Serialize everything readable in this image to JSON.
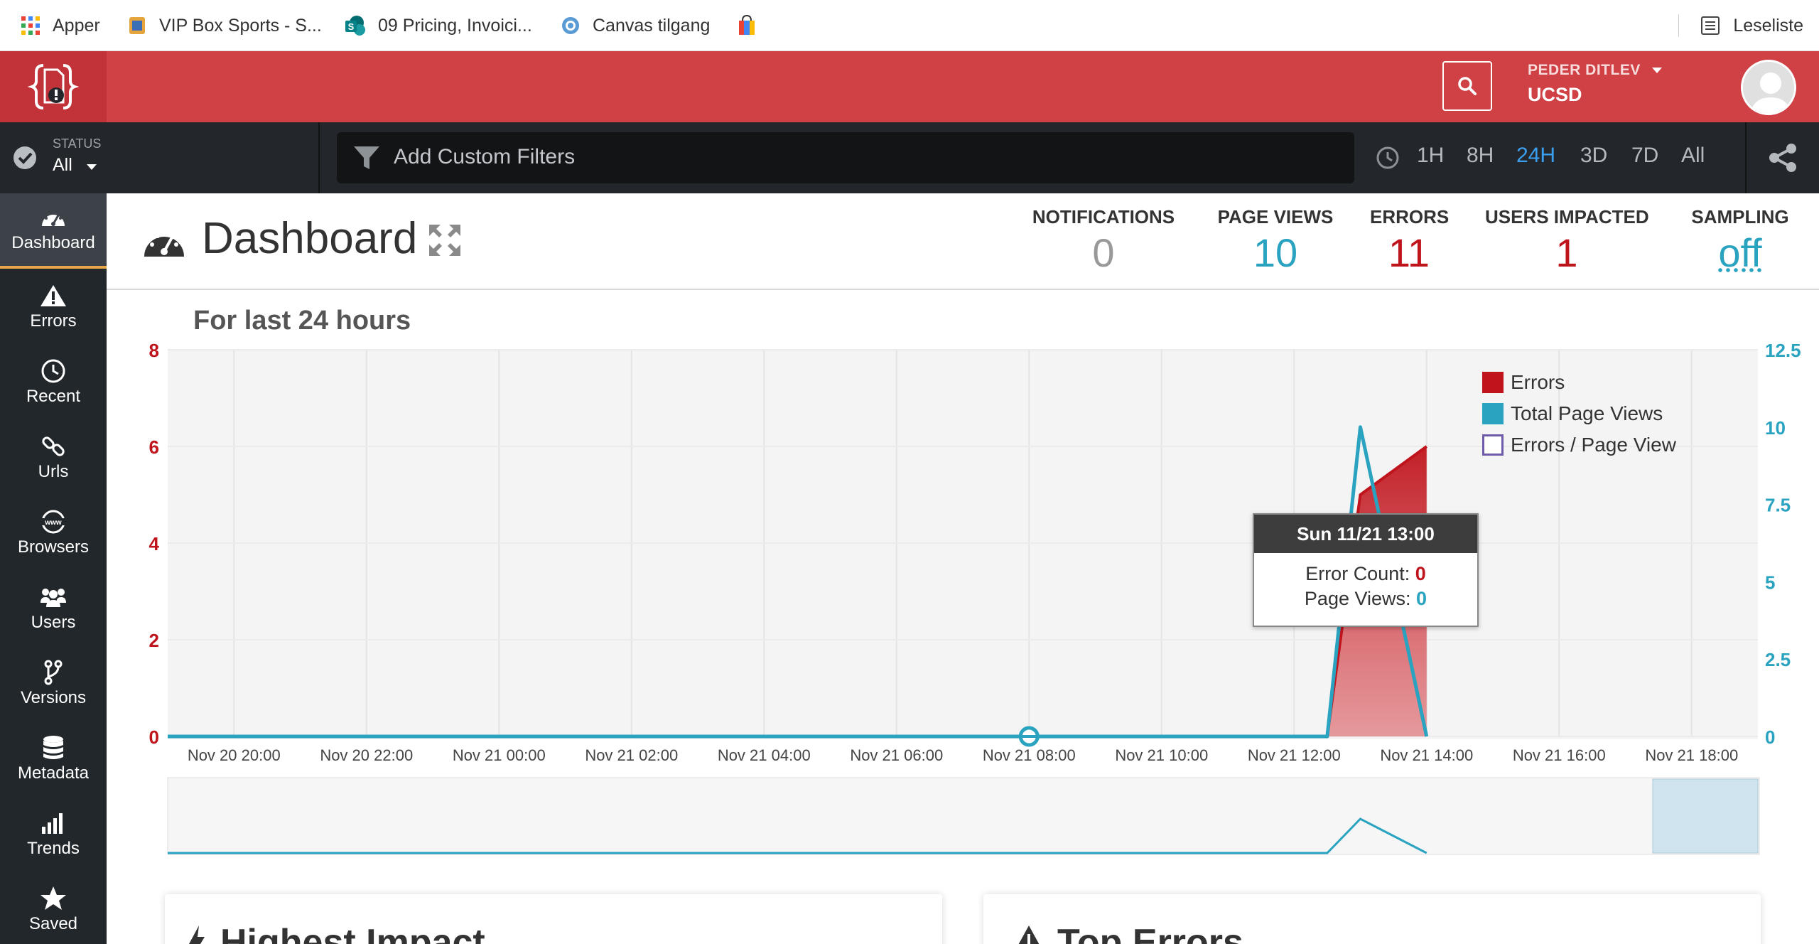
{
  "bookmarks": [
    {
      "label": "Apper",
      "icon": "apps-grid-icon"
    },
    {
      "label": "VIP Box Sports - S...",
      "icon": "vipbox-icon"
    },
    {
      "label": "09 Pricing, Invoici...",
      "icon": "sharepoint-icon"
    },
    {
      "label": "Canvas tilgang",
      "icon": "canvas-icon"
    },
    {
      "label": "",
      "icon": "shopping-bag-icon"
    }
  ],
  "reading_list": "Leseliste",
  "header": {
    "user_name": "PEDER DITLEV",
    "org": "UCSD"
  },
  "filterbar": {
    "status_label": "STATUS",
    "status_value": "All",
    "filter_placeholder": "Add Custom Filters",
    "ranges": [
      "1H",
      "8H",
      "24H",
      "3D",
      "7D",
      "All"
    ],
    "active_range": "24H"
  },
  "sidebar": [
    {
      "label": "Dashboard",
      "icon": "dashboard-gauge-icon",
      "active": true
    },
    {
      "label": "Errors",
      "icon": "warning-icon"
    },
    {
      "label": "Recent",
      "icon": "clock-icon"
    },
    {
      "label": "Urls",
      "icon": "link-icon"
    },
    {
      "label": "Browsers",
      "icon": "www-globe-icon"
    },
    {
      "label": "Users",
      "icon": "users-icon"
    },
    {
      "label": "Versions",
      "icon": "branch-icon"
    },
    {
      "label": "Metadata",
      "icon": "database-icon"
    },
    {
      "label": "Trends",
      "icon": "bar-chart-icon"
    },
    {
      "label": "Saved",
      "icon": "star-icon"
    }
  ],
  "dashboard": {
    "title": "Dashboard",
    "stats": [
      {
        "label": "NOTIFICATIONS",
        "value": "0",
        "color": "#999999"
      },
      {
        "label": "PAGE VIEWS",
        "value": "10",
        "color": "#2aa3c0"
      },
      {
        "label": "ERRORS",
        "value": "11",
        "color": "#c0141c"
      },
      {
        "label": "USERS IMPACTED",
        "value": "1",
        "color": "#c0141c"
      },
      {
        "label": "SAMPLING",
        "value": "off",
        "color": "#2aa3c0"
      }
    ]
  },
  "chart_title": "For last 24 hours",
  "tooltip": {
    "header": "Sun 11/21 13:00",
    "error_label": "Error Count:",
    "error_value": "0",
    "views_label": "Page Views:",
    "views_value": "0"
  },
  "colors": {
    "errors": "#c0141c",
    "page_views": "#2aa3c0",
    "ratio": "#6e5aa8",
    "brand_red": "#d04146"
  },
  "chart_data": {
    "type": "area",
    "categories": [
      "Nov 20 20:00",
      "Nov 20 22:00",
      "Nov 21 00:00",
      "Nov 21 02:00",
      "Nov 21 04:00",
      "Nov 21 06:00",
      "Nov 21 08:00",
      "Nov 21 10:00",
      "Nov 21 12:00",
      "Nov 21 14:00",
      "Nov 21 16:00",
      "Nov 21 18:00"
    ],
    "y_left_ticks": [
      "0",
      "2",
      "4",
      "6",
      "8"
    ],
    "y_right_ticks": [
      "0",
      "2.5",
      "5",
      "7.5",
      "10",
      "12.5"
    ],
    "ylim_left": [
      0,
      8
    ],
    "ylim_right": [
      0,
      12.5
    ],
    "xlim_hours": [
      -1,
      23
    ],
    "series": [
      {
        "name": "Errors",
        "axis": "left",
        "points": [
          [
            -1,
            0
          ],
          [
            16.5,
            0
          ],
          [
            17,
            5
          ],
          [
            18,
            6
          ]
        ]
      },
      {
        "name": "Total Page Views",
        "axis": "right",
        "points": [
          [
            -1,
            0
          ],
          [
            16.5,
            0
          ],
          [
            17,
            10
          ],
          [
            18,
            0
          ]
        ]
      },
      {
        "name": "Errors / Page View",
        "axis": "left",
        "points": []
      }
    ],
    "highlight_point": {
      "x": 12,
      "y": 0
    },
    "legend_position": "top-right",
    "grid": true
  },
  "panels": [
    {
      "title": "Highest Impact",
      "icon": "bolt-icon"
    },
    {
      "title": "Top Errors",
      "icon": "warning-icon"
    }
  ]
}
